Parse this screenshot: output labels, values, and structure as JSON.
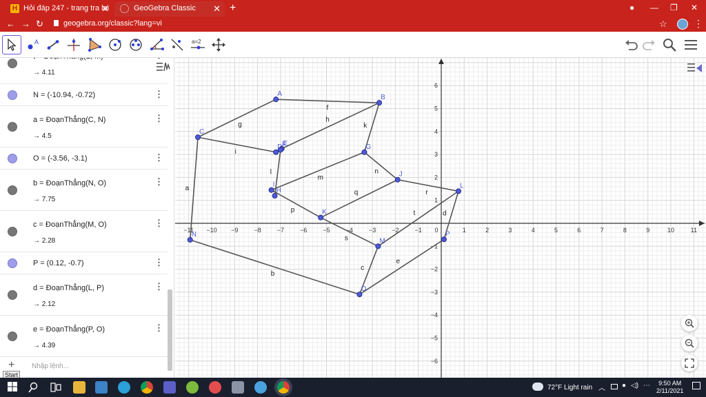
{
  "browser": {
    "tabs": [
      {
        "label": "Hỏi đáp 247 - trang tra loi"
      },
      {
        "label": "GeoGebra Classic"
      }
    ],
    "url": "geogebra.org/classic?lang=vi"
  },
  "algebra": {
    "rows": [
      {
        "kind": "seg",
        "def": "t = ĐoạnThẳng(L, M)",
        "val": "→ 4.11"
      },
      {
        "kind": "pt",
        "def": "N = (-10.94, -0.72)"
      },
      {
        "kind": "seg",
        "def": "a = ĐoạnThẳng(C, N)",
        "val": "→ 4.5"
      },
      {
        "kind": "pt",
        "def": "O = (-3.56, -3.1)"
      },
      {
        "kind": "seg",
        "def": "b = ĐoạnThẳng(N, O)",
        "val": "→ 7.75"
      },
      {
        "kind": "seg",
        "def": "c = ĐoạnThẳng(M, O)",
        "val": "→ 2.28"
      },
      {
        "kind": "pt",
        "def": "P = (0.12, -0.7)"
      },
      {
        "kind": "seg",
        "def": "d = ĐoạnThẳng(L, P)",
        "val": "→ 2.12"
      },
      {
        "kind": "seg",
        "def": "e = ĐoạnThẳng(P, O)",
        "val": "→ 4.39"
      }
    ],
    "input_placeholder": "Nhập lệnh...",
    "start_label": "Start"
  },
  "graph": {
    "points": {
      "A": [
        -7.2,
        5.4
      ],
      "B": [
        -2.7,
        5.25
      ],
      "C": [
        -10.6,
        3.75
      ],
      "D": [
        -7.2,
        3.1
      ],
      "E": [
        -6.95,
        3.25
      ],
      "F": [
        -7.0,
        3.2
      ],
      "G": [
        -3.35,
        3.1
      ],
      "H": [
        -7.25,
        1.2
      ],
      "I": [
        -7.4,
        1.45
      ],
      "J": [
        -1.9,
        1.9
      ],
      "K": [
        -5.25,
        0.25
      ],
      "L": [
        0.75,
        1.4
      ],
      "M": [
        -2.75,
        -1.0
      ],
      "N": [
        -10.94,
        -0.72
      ],
      "O": [
        -3.56,
        -3.1
      ],
      "P": [
        0.12,
        -0.7
      ]
    },
    "segments": [
      {
        "n": "g",
        "p": [
          "C",
          "A"
        ]
      },
      {
        "n": "f",
        "p": [
          "A",
          "B"
        ]
      },
      {
        "n": "h",
        "p": [
          "B",
          "E"
        ]
      },
      {
        "n": "k",
        "p": [
          "B",
          "G"
        ]
      },
      {
        "n": "i",
        "p": [
          "C",
          "D"
        ]
      },
      {
        "n": "a",
        "p": [
          "C",
          "N"
        ]
      },
      {
        "n": "l",
        "p": [
          "F",
          "H"
        ]
      },
      {
        "n": "m",
        "p": [
          "I",
          "G"
        ]
      },
      {
        "n": "n",
        "p": [
          "G",
          "J"
        ]
      },
      {
        "n": "r",
        "p": [
          "J",
          "L"
        ]
      },
      {
        "n": "q",
        "p": [
          "J",
          "K"
        ]
      },
      {
        "n": "p",
        "p": [
          "I",
          "K"
        ]
      },
      {
        "n": "s",
        "p": [
          "K",
          "M"
        ]
      },
      {
        "n": "t",
        "p": [
          "L",
          "M"
        ]
      },
      {
        "n": "d",
        "p": [
          "L",
          "P"
        ]
      },
      {
        "n": "c",
        "p": [
          "M",
          "O"
        ]
      },
      {
        "n": "e",
        "p": [
          "P",
          "O"
        ]
      },
      {
        "n": "b",
        "p": [
          "N",
          "O"
        ]
      }
    ],
    "x_ticks": [
      "−11",
      "−10",
      "−9",
      "−8",
      "−7",
      "−6",
      "−5",
      "−4",
      "−3",
      "−2",
      "−1",
      "0",
      "1",
      "2",
      "3",
      "4",
      "5",
      "6",
      "7",
      "8",
      "9",
      "10",
      "11"
    ],
    "y_ticks": [
      "6",
      "5",
      "4",
      "3",
      "2",
      "1",
      "−1",
      "−2",
      "−3",
      "−4",
      "−5",
      "−6"
    ]
  },
  "taskbar": {
    "weather": "72°F  Light rain",
    "time": "9:50 AM",
    "date": "2/11/2021"
  }
}
